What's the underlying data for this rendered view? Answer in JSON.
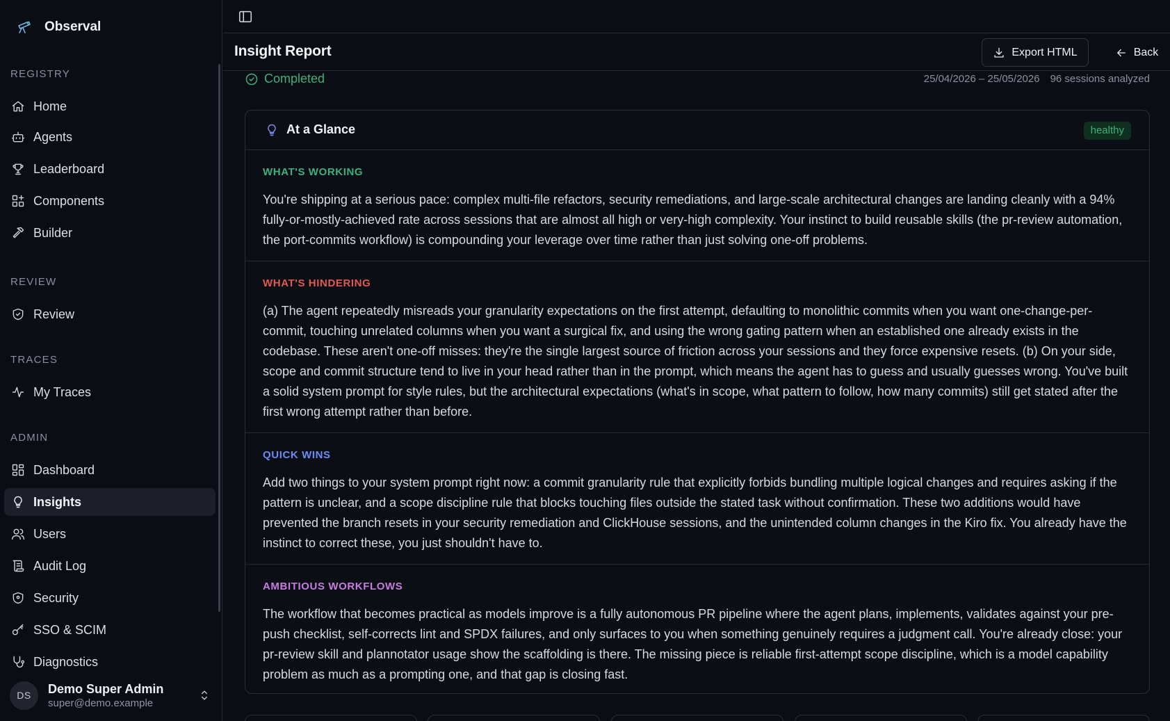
{
  "app": {
    "name": "Observal"
  },
  "sidebar": {
    "sections": [
      {
        "heading": "REGISTRY",
        "items": [
          {
            "label": "Home",
            "icon": "home-icon"
          },
          {
            "label": "Agents",
            "icon": "bot-icon"
          },
          {
            "label": "Leaderboard",
            "icon": "trophy-icon"
          },
          {
            "label": "Components",
            "icon": "grid-plus-icon"
          },
          {
            "label": "Builder",
            "icon": "hammer-icon"
          }
        ]
      },
      {
        "heading": "REVIEW",
        "items": [
          {
            "label": "Review",
            "icon": "shield-check-icon"
          }
        ]
      },
      {
        "heading": "TRACES",
        "items": [
          {
            "label": "My Traces",
            "icon": "activity-icon"
          }
        ]
      },
      {
        "heading": "ADMIN",
        "items": [
          {
            "label": "Dashboard",
            "icon": "dashboard-icon"
          },
          {
            "label": "Insights",
            "icon": "lightbulb-icon",
            "active": true
          },
          {
            "label": "Users",
            "icon": "users-icon"
          },
          {
            "label": "Audit Log",
            "icon": "scroll-icon"
          },
          {
            "label": "Security",
            "icon": "shield-icon"
          },
          {
            "label": "SSO & SCIM",
            "icon": "key-icon"
          },
          {
            "label": "Diagnostics",
            "icon": "stethoscope-icon"
          }
        ]
      }
    ],
    "user": {
      "initials": "DS",
      "name": "Demo Super Admin",
      "email": "super@demo.example"
    }
  },
  "header": {
    "title": "Insight Report",
    "export_label": "Export HTML",
    "back_label": "Back"
  },
  "report": {
    "status": "Completed",
    "date_range": "25/04/2026 – 25/05/2026",
    "sessions": "96 sessions analyzed",
    "glance": {
      "title": "At a Glance",
      "badge": "healthy",
      "sections": [
        {
          "label": "WHAT'S WORKING",
          "tone": "green",
          "body": "You're shipping at a serious pace: complex multi-file refactors, security remediations, and large-scale architectural changes are landing cleanly with a 94% fully-or-mostly-achieved rate across sessions that are almost all high or very-high complexity. Your instinct to build reusable skills (the pr-review automation, the port-commits workflow) is compounding your leverage over time rather than just solving one-off problems."
        },
        {
          "label": "WHAT'S HINDERING",
          "tone": "red",
          "body": "(a) The agent repeatedly misreads your granularity expectations on the first attempt, defaulting to monolithic commits when you want one-change-per-commit, touching unrelated columns when you want a surgical fix, and using the wrong gating pattern when an established one already exists in the codebase. These aren't one-off misses: they're the single largest source of friction across your sessions and they force expensive resets. (b) On your side, scope and commit structure tend to live in your head rather than in the prompt, which means the agent has to guess and usually guesses wrong. You've built a solid system prompt for style rules, but the architectural expectations (what's in scope, what pattern to follow, how many commits) still get stated after the first wrong attempt rather than before."
        },
        {
          "label": "QUICK WINS",
          "tone": "blue",
          "body": "Add two things to your system prompt right now: a commit granularity rule that explicitly forbids bundling multiple logical changes and requires asking if the pattern is unclear, and a scope discipline rule that blocks touching files outside the stated task without confirmation. These two additions would have prevented the branch resets in your security remediation and ClickHouse sessions, and the unintended column changes in the Kiro fix. You already have the instinct to correct these, you just shouldn't have to."
        },
        {
          "label": "AMBITIOUS WORKFLOWS",
          "tone": "purple",
          "body": "The workflow that becomes practical as models improve is a fully autonomous PR pipeline where the agent plans, implements, validates against your pre-push checklist, self-corrects lint and SPDX failures, and only surfaces to you when something genuinely requires a judgment call. You're already close: your pr-review skill and plannotator usage show the scaffolding is there. The missing piece is reliable first-attempt scope discipline, which is a model capability problem as much as a prompting one, and that gap is closing fast."
        }
      ]
    }
  }
}
